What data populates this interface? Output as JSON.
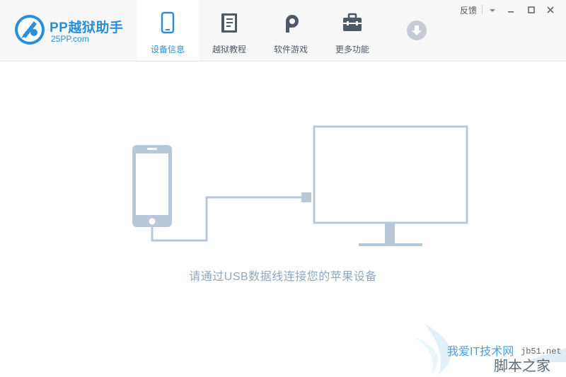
{
  "app": {
    "name": "PP越狱助手",
    "site": "25PP.com"
  },
  "tabs": [
    {
      "label": "设备信息",
      "icon": "phone-icon",
      "active": true
    },
    {
      "label": "越狱教程",
      "icon": "book-icon",
      "active": false
    },
    {
      "label": "软件游戏",
      "icon": "pp-logo-icon",
      "active": false
    },
    {
      "label": "更多功能",
      "icon": "toolbox-icon",
      "active": false
    }
  ],
  "download": {
    "icon": "download-icon"
  },
  "window": {
    "feedback_label": "反馈",
    "menu_icon": "dropdown-icon",
    "minimize_icon": "minimize-icon",
    "maximize_icon": "maximize-icon",
    "close_icon": "close-icon"
  },
  "main": {
    "hint": "请通过USB数据线连接您的苹果设备",
    "illustration_color": "#b9c8d8"
  },
  "watermark": {
    "line1": "我爱IT技术网",
    "site": "jb51.net",
    "line2": "脚本之家"
  },
  "colors": {
    "accent": "#2b8fd8",
    "tab_icon": "#4d5a66",
    "header_bg": "#f7f7f7"
  }
}
